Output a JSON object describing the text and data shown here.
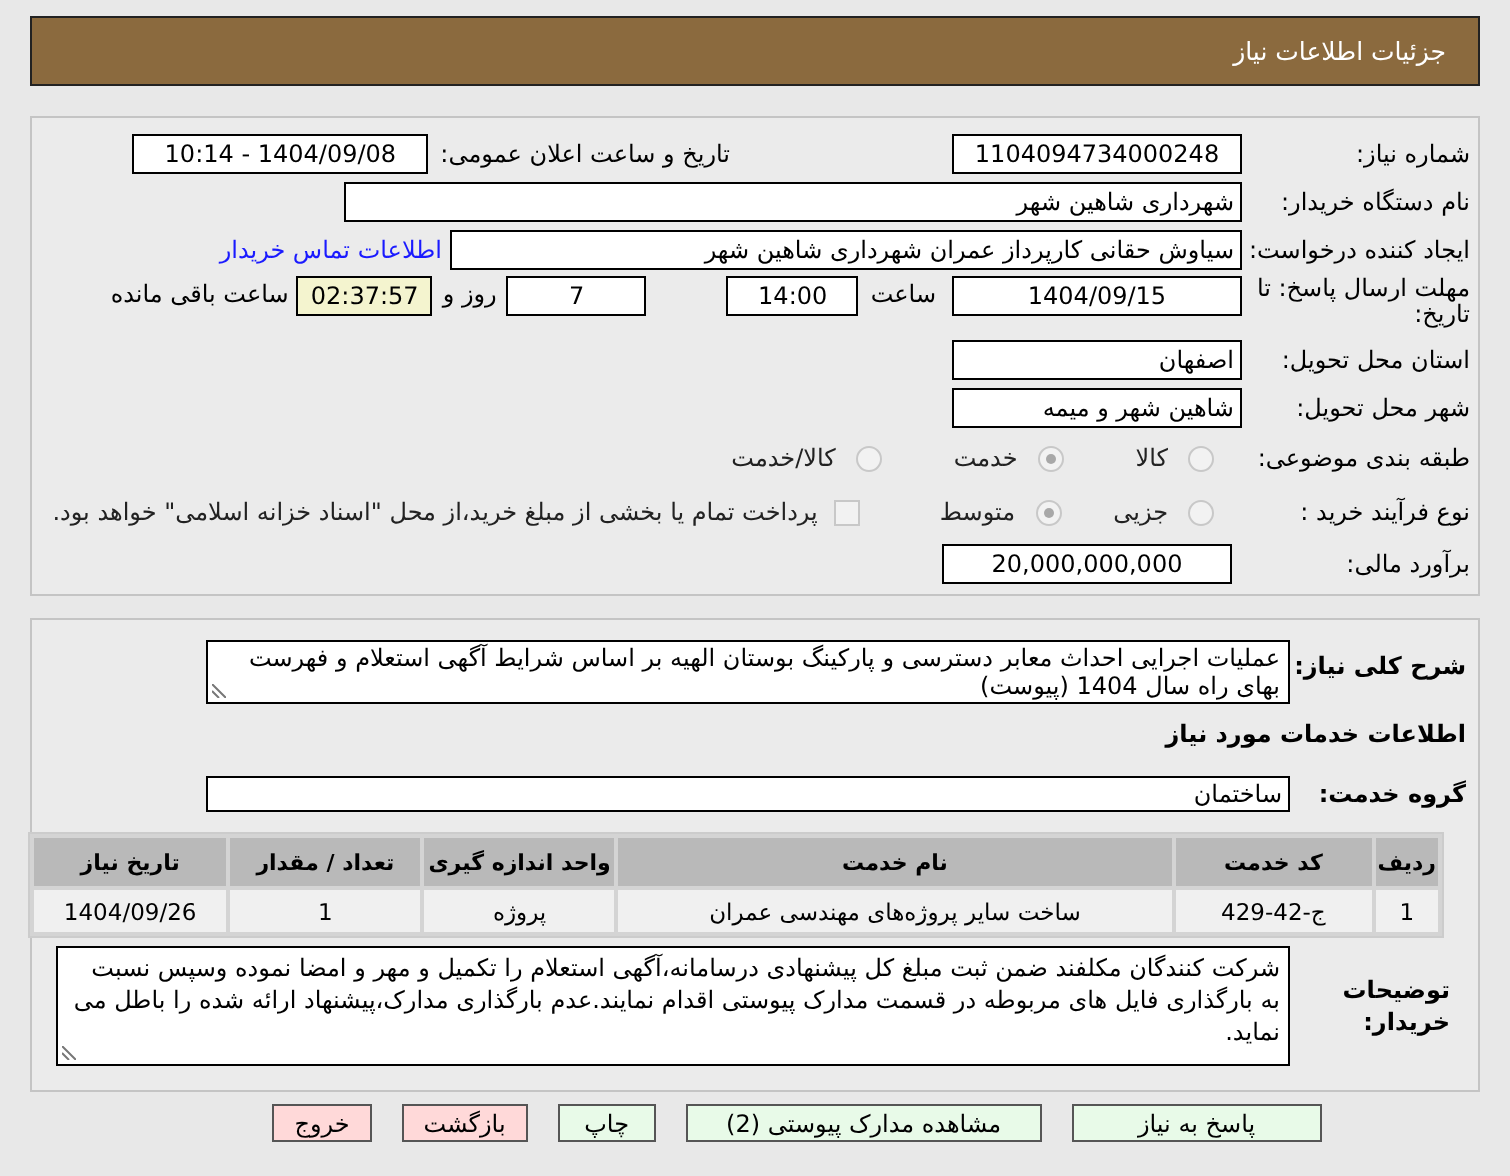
{
  "header": {
    "title": "جزئیات اطلاعات نیاز"
  },
  "info": {
    "need_number": {
      "label": "شماره نیاز:",
      "value": "1104094734000248"
    },
    "announce": {
      "label": "تاریخ و ساعت اعلان عمومی:",
      "value": "1404/09/08 - 10:14"
    },
    "buyer": {
      "label": "نام دستگاه خریدار:",
      "value": "شهرداری شاهین شهر"
    },
    "creator": {
      "label": "ایجاد کننده درخواست:",
      "value": "سیاوش حقانی کارپرداز عمران شهرداری شاهین شهر",
      "link": "اطلاعات تماس خریدار"
    },
    "deadline": {
      "label": "مهلت ارسال پاسخ: تا تاریخ:",
      "date": "1404/09/15",
      "time_label": "ساعت",
      "time": "14:00",
      "days": "7",
      "days_label": "روز و",
      "remaining": "02:37:57",
      "remaining_label": "ساعت باقی مانده"
    },
    "province": {
      "label": "استان محل تحویل:",
      "value": "اصفهان"
    },
    "city": {
      "label": "شهر محل تحویل:",
      "value": "شاهین شهر و میمه"
    },
    "category": {
      "label": "طبقه بندی موضوعی:",
      "options": [
        {
          "label": "کالا",
          "selected": false
        },
        {
          "label": "خدمت",
          "selected": true
        },
        {
          "label": "کالا/خدمت",
          "selected": false
        }
      ]
    },
    "process": {
      "label": "نوع فرآیند خرید :",
      "options": [
        {
          "label": "جزیی",
          "selected": false
        },
        {
          "label": "متوسط",
          "selected": true
        }
      ],
      "payment": {
        "label": "پرداخت تمام یا بخشی از مبلغ خرید،از محل \"اسناد خزانه اسلامی\" خواهد بود.",
        "checked": false
      }
    },
    "budget": {
      "label": "برآورد مالی:",
      "value": "20,000,000,000"
    }
  },
  "details": {
    "description": {
      "label": "شرح کلی نیاز:",
      "value": "عملیات اجرایی احداث معابر دسترسی و پارکینگ بوستان الهیه بر اساس شرایط آگهی استعلام و فهرست بهای راه سال 1404 (پیوست)"
    },
    "services_title": "اطلاعات خدمات مورد نیاز",
    "group": {
      "label": "گروه خدمت:",
      "value": "ساختمان"
    },
    "table": {
      "columns": [
        "ردیف",
        "کد خدمت",
        "نام خدمت",
        "واحد اندازه گیری",
        "تعداد / مقدار",
        "تاریخ نیاز"
      ],
      "rows": [
        [
          "1",
          "ج-42-429",
          "ساخت سایر پروژه‌های مهندسی عمران",
          "پروژه",
          "1",
          "1404/09/26"
        ]
      ]
    },
    "notes": {
      "label": "توضیحات خریدار:",
      "value": "شرکت کنندگان مکلفند ضمن ثبت مبلغ کل پیشنهادی درسامانه،آگهی استعلام را  تکمیل و مهر و امضا نموده وسپس نسبت به بارگذاری فایل های مربوطه در قسمت مدارک پیوستی اقدام نمایند.عدم بارگذاری مدارک،پیشنهاد ارائه شده را باطل می نماید."
    }
  },
  "buttons": [
    {
      "label": "پاسخ به نیاز",
      "kind": "primary"
    },
    {
      "label": "مشاهده مدارک پیوستی (2)",
      "kind": "primary"
    },
    {
      "label": "چاپ",
      "kind": "primary"
    },
    {
      "label": "بازگشت",
      "kind": "danger"
    },
    {
      "label": "خروج",
      "kind": "danger"
    }
  ]
}
